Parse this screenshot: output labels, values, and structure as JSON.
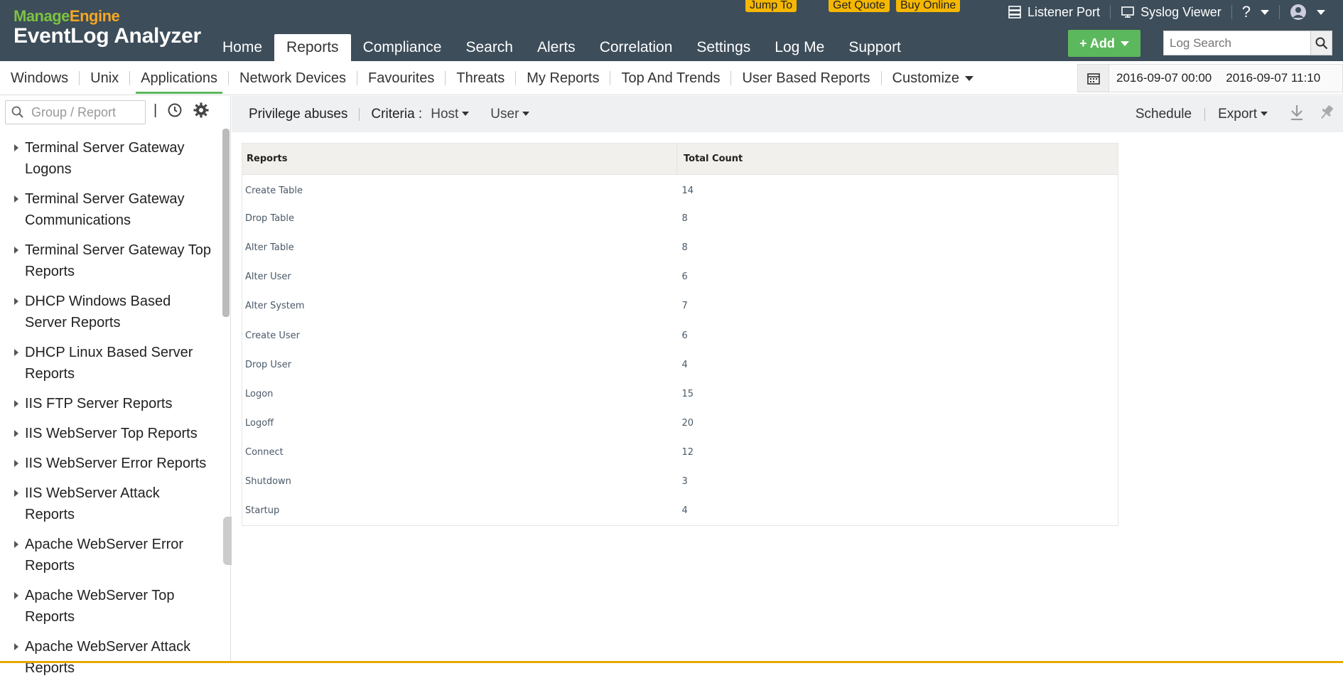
{
  "app": {
    "brand_part1": "Manage",
    "brand_part2": "Engine",
    "product": "EventLog Analyzer"
  },
  "header": {
    "jump_to": "Jump To",
    "get_quote": "Get Quote",
    "buy_online": "Buy Online",
    "listener_port": "Listener Port",
    "syslog_viewer": "Syslog Viewer",
    "help": "?",
    "add_label": "+ Add",
    "log_search_placeholder": "Log Search"
  },
  "main_nav": [
    "Home",
    "Reports",
    "Compliance",
    "Search",
    "Alerts",
    "Correlation",
    "Settings",
    "Log Me",
    "Support"
  ],
  "main_nav_active": "Reports",
  "sub_nav": [
    "Windows",
    "Unix",
    "Applications",
    "Network Devices",
    "Favourites",
    "Threats",
    "My Reports",
    "Top And Trends",
    "User Based Reports"
  ],
  "sub_nav_active": "Applications",
  "customize_label": "Customize",
  "date_range": {
    "from": "2016-09-07 00:00",
    "to": "2016-09-07 11:10"
  },
  "sidebar": {
    "search_placeholder": "Group / Report",
    "separator": "|",
    "items": [
      "Terminal Server Gateway Logons",
      "Terminal Server Gateway Communications",
      "Terminal Server Gateway Top Reports",
      "DHCP Windows Based Server Reports",
      "DHCP Linux Based Server Reports",
      "IIS FTP Server Reports",
      "IIS WebServer Top Reports",
      "IIS WebServer Error Reports",
      "IIS WebServer Attack Reports",
      "Apache WebServer Error Reports",
      "Apache WebServer Top Reports",
      "Apache WebServer Attack Reports"
    ]
  },
  "toolbar": {
    "title": "Privilege abuses",
    "criteria_label": "Criteria :",
    "host_label": "Host",
    "user_label": "User",
    "schedule_label": "Schedule",
    "export_label": "Export"
  },
  "table": {
    "columns": [
      "Reports",
      "Total Count"
    ],
    "rows": [
      [
        "Create Table",
        "14"
      ],
      [
        "Drop Table",
        "8"
      ],
      [
        "Alter Table",
        "8"
      ],
      [
        "Alter User",
        "6"
      ],
      [
        "Alter System",
        "7"
      ],
      [
        "Create User",
        "6"
      ],
      [
        "Drop User",
        "4"
      ],
      [
        "Logon",
        "15"
      ],
      [
        "Logoff",
        "20"
      ],
      [
        "Connect",
        "12"
      ],
      [
        "Shutdown",
        "3"
      ],
      [
        "Startup",
        "4"
      ]
    ]
  },
  "colors": {
    "header_bg": "#3d4d5a",
    "accent_green": "#5cb85c",
    "highlight_yellow": "#f5b700"
  }
}
